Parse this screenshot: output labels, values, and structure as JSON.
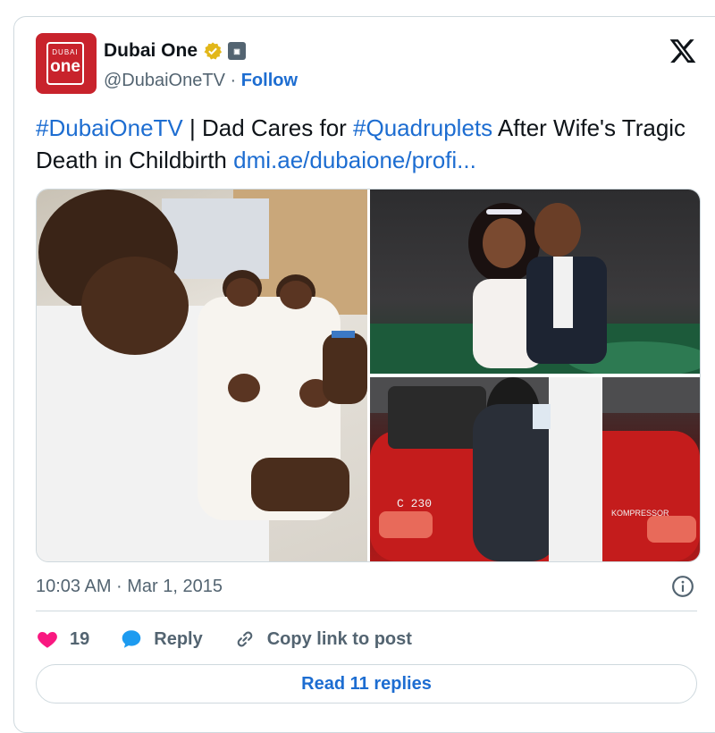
{
  "account": {
    "avatar_text_top": "DUBAI",
    "avatar_text_main": "one",
    "display_name": "Dubai One",
    "handle": "@DubaiOneTV",
    "separator": " · ",
    "follow_label": "Follow"
  },
  "tweet": {
    "hashtag1": "#DubaiOneTV",
    "text1": " | Dad Cares for ",
    "hashtag2": "#Quadruplets",
    "text2": " After Wife's Tragic Death in Childbirth ",
    "link": "dmi.ae/dubaione/profi..."
  },
  "media": {
    "photo2_caption_text": "C 230",
    "photo3_caption_text": "KOMPRESSOR"
  },
  "meta": {
    "timestamp": "10:03 AM · Mar 1, 2015"
  },
  "actions": {
    "like_count": "19",
    "reply_label": "Reply",
    "copy_label": "Copy link to post"
  },
  "read_replies_label": "Read 11 replies",
  "colors": {
    "link": "#1d6dd1",
    "like": "#f91880",
    "reply_icon": "#1d9bf0",
    "avatar_bg": "#c8232c"
  }
}
